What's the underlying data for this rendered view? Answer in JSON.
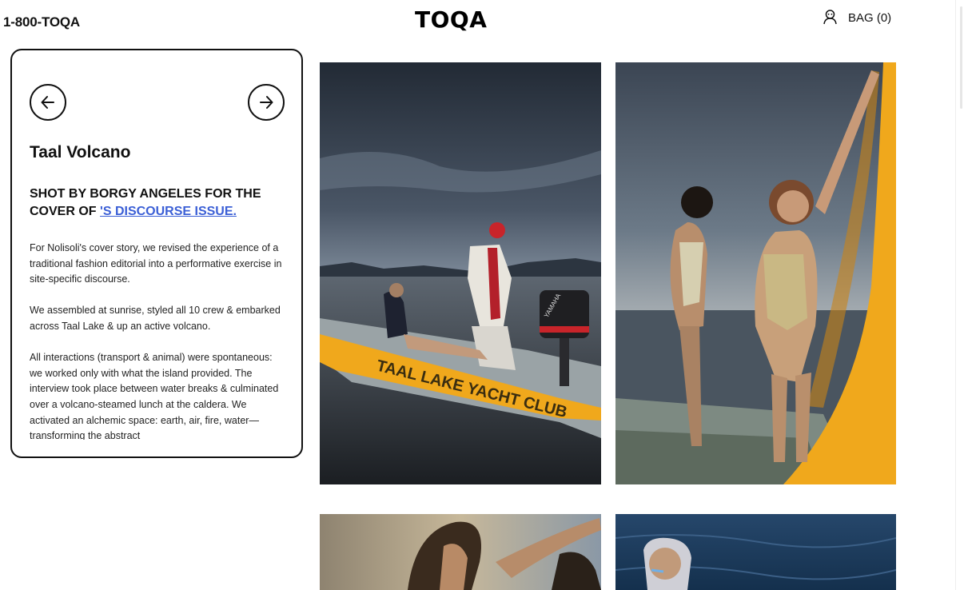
{
  "header": {
    "phone": "1-800-TOQA",
    "logo": "TOQA",
    "bag_label": "BAG (0)"
  },
  "icons": {
    "account": "user-icon",
    "prev": "arrow-left-icon",
    "next": "arrow-right-icon"
  },
  "story": {
    "title": "Taal Volcano",
    "subtitle_prefix": "SHOT BY BORGY ANGELES FOR THE COVER OF ",
    "subtitle_link": "'S DISCOURSE ISSUE.",
    "paragraphs": [
      "For Nolisoli's cover story, we revised the experience of a traditional fashion editorial into a performative exercise in site-specific discourse.",
      "We assembled at sunrise, styled all 10 crew & embarked across Taal Lake & up an active volcano.",
      "All interactions (transport & animal) were spontaneous: we worked only with what the island provided. The interview took place between water breaks & culminated over a volcano-steamed lunch at the caldera. We activated an alchemic space: earth, air, fire, water— transforming the abstract"
    ]
  },
  "photos": [
    {
      "subject": "Two models on a boat on Taal Lake at dawn",
      "boat_text": "TAAL LAKE YACHT CLUB",
      "motor_text": "YAMAHA"
    },
    {
      "subject": "Two models in metallic swimsuits beside a yellow boat hull"
    },
    {
      "subject": "Model with windswept hair against the sky"
    },
    {
      "subject": "Model in a cap beside blue water"
    }
  ],
  "colors": {
    "link": "#3b5fd6",
    "boat_yellow": "#f0a81c",
    "sky_dark": "#3a4452"
  }
}
